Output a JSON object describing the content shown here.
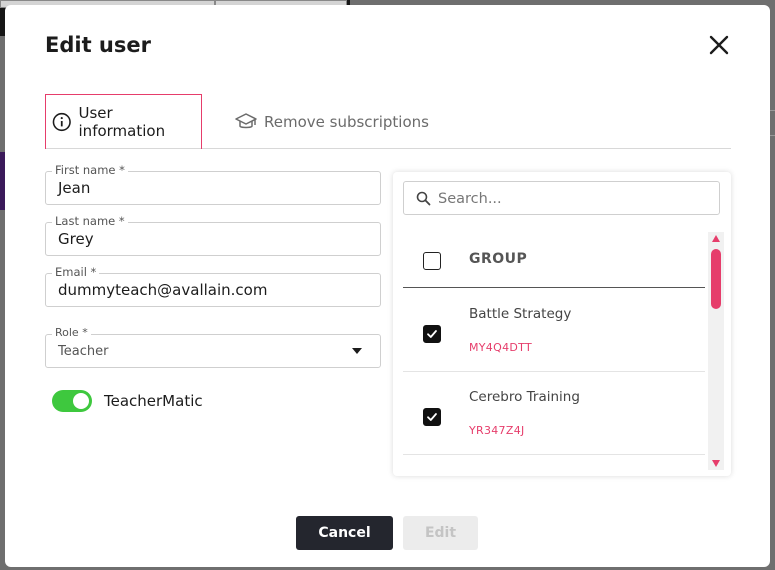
{
  "dialog": {
    "title": "Edit user",
    "close_icon": "close-icon"
  },
  "tabs": [
    {
      "label": "User information",
      "icon": "info-icon",
      "active": true
    },
    {
      "label": "Remove subscriptions",
      "icon": "graduation-cap-icon",
      "active": false
    }
  ],
  "form": {
    "first_name": {
      "label": "First name *",
      "value": "Jean"
    },
    "last_name": {
      "label": "Last name *",
      "value": "Grey"
    },
    "email": {
      "label": "Email *",
      "value": "dummyteach@avallain.com"
    },
    "role": {
      "label": "Role *",
      "value": "Teacher"
    },
    "teachermatic": {
      "label": "TeacherMatic",
      "enabled": true
    }
  },
  "groups": {
    "search_placeholder": "Search...",
    "header": "GROUP",
    "items": [
      {
        "name": "Battle Strategy",
        "code": "MY4Q4DTT",
        "checked": true
      },
      {
        "name": "Cerebro Training",
        "code": "YR347Z4J",
        "checked": true
      }
    ]
  },
  "actions": {
    "cancel_label": "Cancel",
    "edit_label": "Edit"
  },
  "colors": {
    "accent": "#e63d6b",
    "toggle_on": "#3ec83e",
    "primary_button": "#24262e"
  }
}
